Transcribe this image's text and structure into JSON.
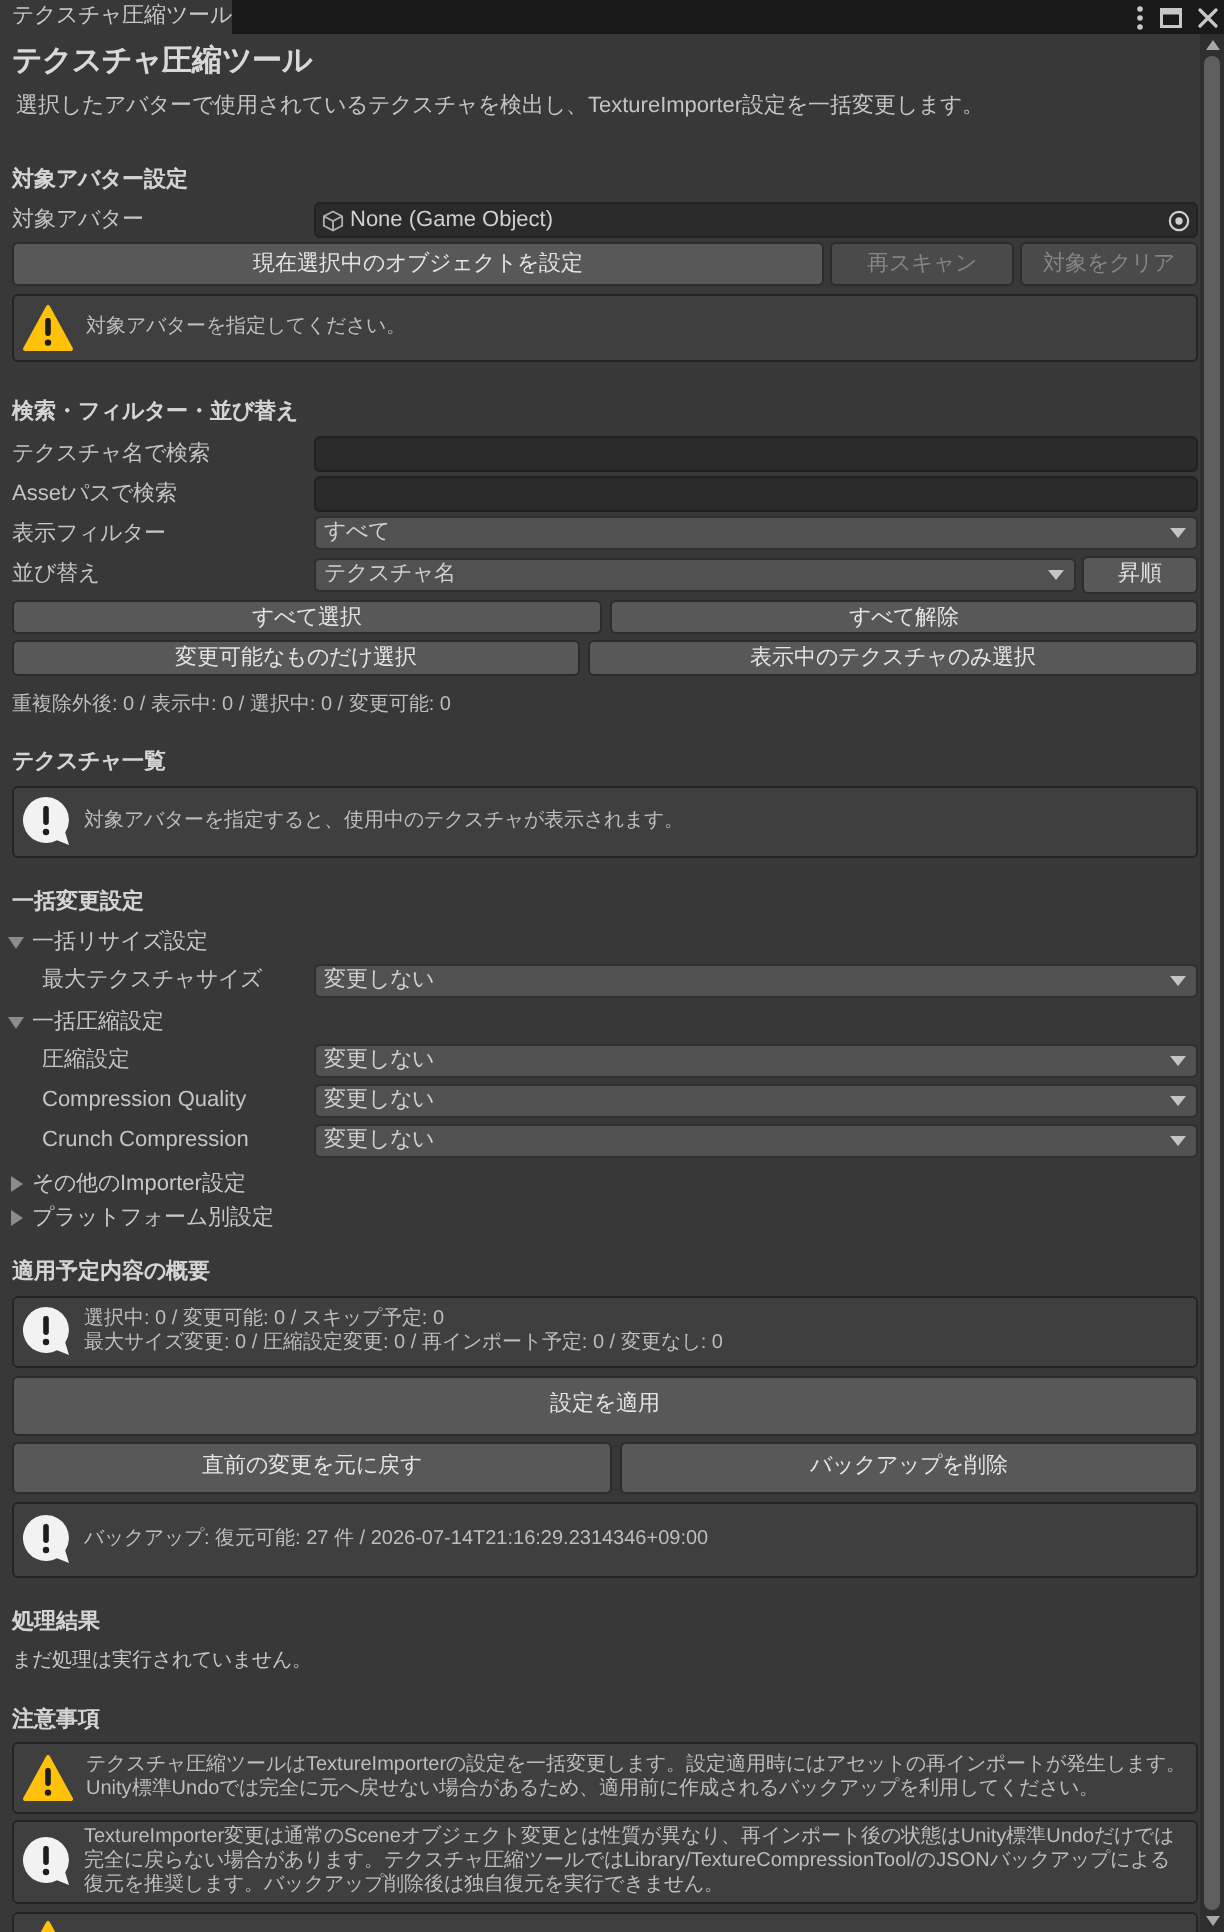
{
  "window": {
    "tab_title": "テクスチャ圧縮ツール"
  },
  "header": {
    "title": "テクスチャ圧縮ツール",
    "description": "選択したアバターで使用されているテクスチャを検出し、TextureImporter設定を一括変更します。"
  },
  "avatar_settings": {
    "heading": "対象アバター設定",
    "field": {
      "label": "対象アバター",
      "value": "None (Game Object)"
    },
    "buttons": [
      {
        "label": "現在選択中のオブジェクトを設定",
        "disabled": false
      },
      {
        "label": "再スキャン",
        "disabled": true
      },
      {
        "label": "対象をクリア",
        "disabled": true
      }
    ],
    "message": {
      "kind": "warning",
      "text": "対象アバターを指定してください。"
    }
  },
  "search_filter_sort": {
    "heading": "検索・フィルター・並び替え",
    "fields": [
      {
        "kind": "text",
        "label": "テクスチャ名で検索"
      },
      {
        "kind": "text",
        "label": "Assetパスで検索"
      },
      {
        "kind": "dropdown",
        "label": "表示フィルター",
        "value": "すべて"
      },
      {
        "kind": "dropdown",
        "label": "並び替え",
        "value": "テクスチャ名",
        "button": "昇順"
      }
    ],
    "button_rows": [
      [
        "すべて選択",
        "すべて解除"
      ],
      [
        "変更可能なものだけ選択",
        "表示中のテクスチャのみ選択"
      ]
    ],
    "counts": "重複除外後: 0 / 表示中: 0 / 選択中: 0 / 変更可能: 0"
  },
  "texture_list": {
    "heading": "テクスチャ一覧",
    "message": {
      "kind": "info",
      "text": "対象アバターを指定すると、使用中のテクスチャが表示されます。"
    }
  },
  "bulk_settings": {
    "heading": "一括変更設定",
    "groups": [
      {
        "label": "一括リサイズ設定",
        "expanded": true,
        "rows": [
          {
            "label": "最大テクスチャサイズ",
            "value": "変更しない"
          }
        ]
      },
      {
        "label": "一括圧縮設定",
        "expanded": true,
        "rows": [
          {
            "label": "圧縮設定",
            "value": "変更しない"
          },
          {
            "label": "Compression Quality",
            "value": "変更しない"
          },
          {
            "label": "Crunch Compression",
            "value": "変更しない"
          }
        ]
      },
      {
        "label": "その他のImporter設定",
        "expanded": false
      },
      {
        "label": "プラットフォーム別設定",
        "expanded": false
      }
    ]
  },
  "summary": {
    "heading": "適用予定内容の概要",
    "message": {
      "kind": "info",
      "text": "選択中: 0 / 変更可能: 0 / スキップ予定: 0\n最大サイズ変更: 0 / 圧縮設定変更: 0 / 再インポート予定: 0 / 変更なし: 0"
    },
    "apply_button": "設定を適用",
    "buttons": [
      "直前の変更を元に戻す",
      "バックアップを削除"
    ],
    "backup_message": {
      "kind": "info",
      "text": "バックアップ: 復元可能: 27 件 / 2026-07-14T21:16:29.2314346+09:00"
    }
  },
  "results": {
    "heading": "処理結果",
    "text": "まだ処理は実行されていません。"
  },
  "notes": {
    "heading": "注意事項",
    "messages": [
      {
        "kind": "warning",
        "text": "テクスチャ圧縮ツールはTextureImporterの設定を一括変更します。設定適用時にはアセットの再インポートが発生します。Unity標準Undoでは完全に元へ戻せない場合があるため、適用前に作成されるバックアップを利用してください。"
      },
      {
        "kind": "info",
        "text": "TextureImporter変更は通常のSceneオブジェクト変更とは性質が異なり、再インポート後の状態はUnity標準Undoだけでは完全に戻らない場合があります。テクスチャ圧縮ツールではLibrary/TextureCompressionTool/のJSONバックアップによる復元を推奨します。バックアップ削除後は独自復元を実行できません。"
      },
      {
        "kind": "warning"
      }
    ]
  }
}
